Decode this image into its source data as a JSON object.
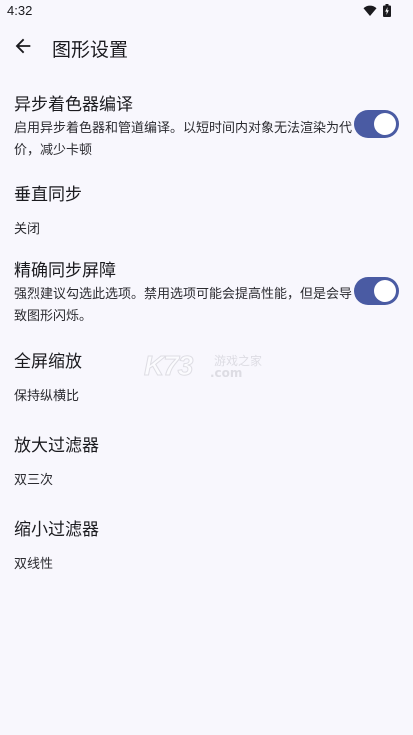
{
  "status_bar": {
    "time": "4:32",
    "icons": [
      "wifi-icon",
      "battery-charging-icon"
    ]
  },
  "app_bar": {
    "back_icon": "arrow-left-icon",
    "title": "图形设置"
  },
  "settings": {
    "async_shader": {
      "title": "异步着色器编译",
      "summary": "启用异步着色器和管道编译。以短时间内对象无法渲染为代价，减少卡顿",
      "enabled": true
    },
    "vsync": {
      "title": "垂直同步",
      "value": "关闭"
    },
    "accurate_sync": {
      "title": "精确同步屏障",
      "summary": "强烈建议勾选此选项。禁用选项可能会提高性能，但是会导致图形闪烁。",
      "enabled": true
    },
    "fullscreen_scaling": {
      "title": "全屏缩放",
      "value": "保持纵横比"
    },
    "mag_filter": {
      "title": "放大过滤器",
      "value": "双三次"
    },
    "min_filter": {
      "title": "缩小过滤器",
      "value": "双线性"
    }
  },
  "watermark": {
    "logo": "K73",
    "text": "游戏之家",
    "domain": ".com"
  },
  "colors": {
    "background": "#f8f7fd",
    "accent": "#4a5ba3",
    "text": "#1b1b1f"
  }
}
